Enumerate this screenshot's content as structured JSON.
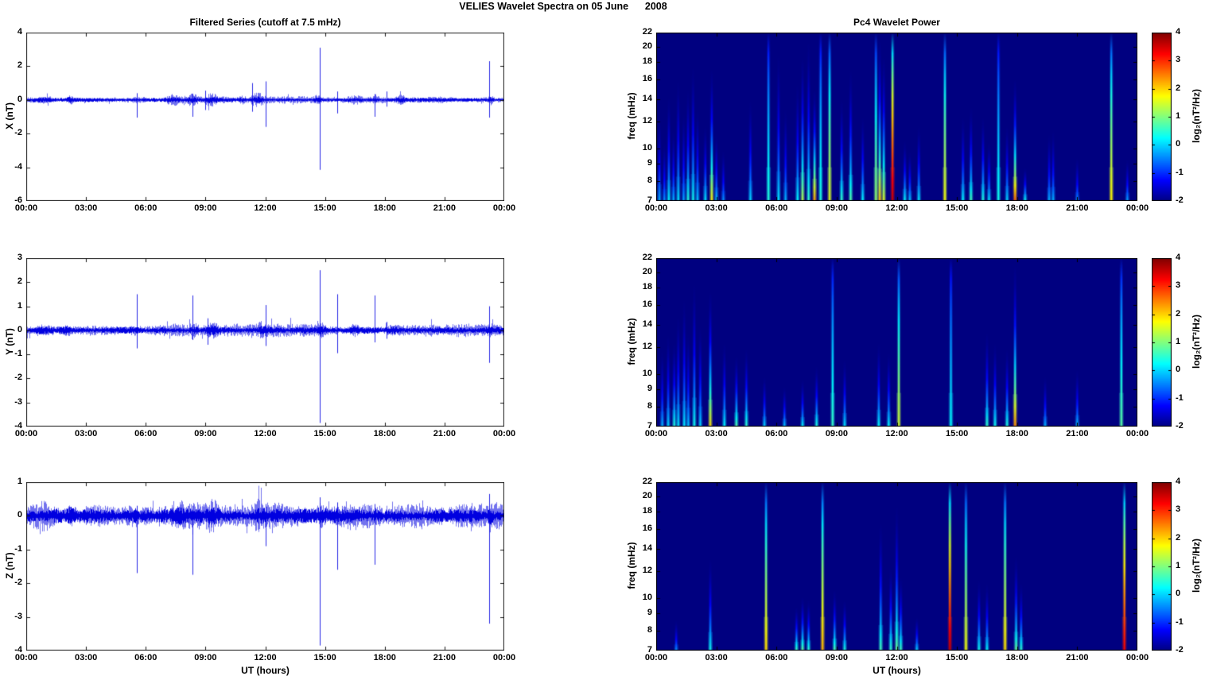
{
  "figure_title": "VELIES Wavelet Spectra on 05 June      2008",
  "ut_label": "UT (hours)",
  "time_ticks": [
    "00:00",
    "03:00",
    "06:00",
    "09:00",
    "12:00",
    "15:00",
    "18:00",
    "21:00",
    "00:00"
  ],
  "colors": {
    "series_line": "#0000e0",
    "axis": "#1a1a1a",
    "spectro_background": "#000080",
    "page_background": "#ffffff"
  },
  "colorbar": {
    "label": "log₂(nT²/Hz)",
    "ticks": [
      "4",
      "3",
      "2",
      "1",
      "0",
      "-1",
      "-2"
    ],
    "range": [
      -2,
      4
    ]
  },
  "chart_data": [
    {
      "type": "line",
      "title": "Filtered Series (cutoff at 7.5 mHz)",
      "ylabel": "X (nT)",
      "xlabel": "",
      "ylim": [
        -6,
        4
      ],
      "yticks": [
        "4",
        "2",
        "0",
        "-2",
        "-4",
        "-6"
      ],
      "xlim_hours": [
        0,
        24
      ],
      "noise_amp": 0.12,
      "bursts": [
        [
          0.9,
          1.6,
          0.06
        ],
        [
          2.2,
          0.5,
          0.1
        ],
        [
          7.4,
          1.2,
          0.1
        ],
        [
          8.3,
          0.8,
          0.12
        ],
        [
          9.3,
          1.0,
          0.14
        ],
        [
          10.8,
          0.6,
          0.08
        ],
        [
          11.6,
          0.9,
          0.16
        ],
        [
          14.6,
          0.6,
          0.1
        ],
        [
          16.4,
          1.4,
          0.07
        ],
        [
          17.5,
          0.5,
          0.08
        ],
        [
          18.8,
          0.7,
          0.09
        ],
        [
          23.3,
          0.5,
          0.12
        ]
      ],
      "spikes": [
        [
          5.55,
          0.4,
          -1.05
        ],
        [
          8.35,
          0.35,
          -1.0
        ],
        [
          9.0,
          0.55,
          -0.6
        ],
        [
          11.35,
          1.0,
          -0.7
        ],
        [
          12.0,
          1.1,
          -1.6
        ],
        [
          14.75,
          3.1,
          -4.15
        ],
        [
          15.6,
          0.5,
          -0.8
        ],
        [
          17.5,
          0.35,
          -1.0
        ],
        [
          18.1,
          0.5,
          -0.4
        ],
        [
          23.25,
          2.3,
          -1.05
        ]
      ]
    },
    {
      "type": "line",
      "title": "",
      "ylabel": "Y (nT)",
      "xlabel": "",
      "ylim": [
        -4,
        3
      ],
      "yticks": [
        "3",
        "2",
        "1",
        "0",
        "-1",
        "-2",
        "-3",
        "-4"
      ],
      "xlim_hours": [
        0,
        24
      ],
      "noise_amp": 0.14,
      "bursts": [
        [
          0.9,
          1.6,
          0.05
        ],
        [
          2.1,
          0.6,
          0.08
        ],
        [
          5.5,
          0.4,
          0.06
        ],
        [
          8.4,
          0.8,
          0.08
        ],
        [
          9.3,
          0.8,
          0.08
        ],
        [
          11.8,
          0.9,
          0.08
        ],
        [
          14.8,
          0.5,
          0.06
        ],
        [
          16.5,
          1.0,
          0.06
        ],
        [
          18.3,
          0.8,
          0.06
        ],
        [
          23.3,
          0.4,
          0.08
        ]
      ],
      "spikes": [
        [
          5.55,
          1.5,
          -0.75
        ],
        [
          8.35,
          1.45,
          -0.4
        ],
        [
          9.1,
          0.5,
          -0.6
        ],
        [
          12.0,
          1.05,
          -0.65
        ],
        [
          14.75,
          2.5,
          -3.85
        ],
        [
          15.6,
          1.5,
          -0.95
        ],
        [
          17.5,
          1.45,
          -0.5
        ],
        [
          18.1,
          0.35,
          -0.35
        ],
        [
          23.25,
          1.0,
          -1.35
        ]
      ]
    },
    {
      "type": "line",
      "title": "",
      "ylabel": "Z (nT)",
      "xlabel": "UT (hours)",
      "ylim": [
        -4,
        1
      ],
      "yticks": [
        "1",
        "0",
        "-1",
        "-2",
        "-3",
        "-4"
      ],
      "xlim_hours": [
        0,
        24
      ],
      "noise_amp": 0.2,
      "bursts": [
        [
          0.9,
          1.4,
          0.05
        ],
        [
          2.2,
          0.6,
          0.06
        ],
        [
          5.5,
          0.4,
          0.06
        ],
        [
          7.6,
          1.4,
          0.08
        ],
        [
          9.3,
          1.0,
          0.08
        ],
        [
          11.7,
          0.9,
          0.1
        ],
        [
          14.7,
          0.5,
          0.06
        ],
        [
          16.3,
          1.2,
          0.06
        ],
        [
          18.6,
          0.8,
          0.06
        ],
        [
          23.3,
          0.4,
          0.1
        ]
      ],
      "spikes": [
        [
          5.55,
          0.3,
          -1.7
        ],
        [
          8.35,
          0.3,
          -1.75
        ],
        [
          12.0,
          0.35,
          -0.9
        ],
        [
          14.75,
          0.55,
          -3.85
        ],
        [
          15.6,
          0.4,
          -1.6
        ],
        [
          17.5,
          0.35,
          -1.45
        ],
        [
          23.25,
          0.65,
          -3.2
        ]
      ]
    },
    {
      "type": "heatmap",
      "title": "Pc4 Wavelet Power",
      "ylabel": "freq (mHz)",
      "xlabel": "",
      "ylim_mhz": [
        7,
        22
      ],
      "yscale": "log",
      "yticks": [
        "22",
        "20",
        "18",
        "16",
        "14",
        "12",
        "10",
        "9",
        "8",
        "7"
      ],
      "xlim_hours": [
        0,
        24
      ],
      "clim": [
        -2,
        4
      ],
      "streaks": [
        [
          0.16,
          0.5,
          0.5
        ],
        [
          0.41,
          0.35,
          0.3
        ],
        [
          0.63,
          0.62,
          0.9
        ],
        [
          0.86,
          0.42,
          0.5
        ],
        [
          1.1,
          0.72,
          0.8
        ],
        [
          1.37,
          0.52,
          0.4
        ],
        [
          1.59,
          0.66,
          1.1
        ],
        [
          1.84,
          0.8,
          1.0
        ],
        [
          2.06,
          0.55,
          0.6
        ],
        [
          2.45,
          0.45,
          0.8
        ],
        [
          2.77,
          0.78,
          2.3
        ],
        [
          3.0,
          0.4,
          0.6
        ],
        [
          3.35,
          0.3,
          0.3
        ],
        [
          4.7,
          0.6,
          0.7
        ],
        [
          5.6,
          1.0,
          1.1
        ],
        [
          6.1,
          0.88,
          0.8
        ],
        [
          6.45,
          0.55,
          0.5
        ],
        [
          7.05,
          0.7,
          0.9
        ],
        [
          7.3,
          0.85,
          1.9
        ],
        [
          7.6,
          0.95,
          1.2
        ],
        [
          7.9,
          0.66,
          2.7
        ],
        [
          8.2,
          1.0,
          1.1
        ],
        [
          8.65,
          1.0,
          2.1
        ],
        [
          9.25,
          0.6,
          1.2
        ],
        [
          9.7,
          0.78,
          1.4
        ],
        [
          10.3,
          0.5,
          0.9
        ],
        [
          10.96,
          1.0,
          1.7
        ],
        [
          11.15,
          0.96,
          2.5
        ],
        [
          11.35,
          0.86,
          2.1
        ],
        [
          11.79,
          1.0,
          3.7
        ],
        [
          12.4,
          0.36,
          0.9
        ],
        [
          12.65,
          0.3,
          0.6
        ],
        [
          13.1,
          0.45,
          0.8
        ],
        [
          14.4,
          1.0,
          2.2
        ],
        [
          15.3,
          0.5,
          0.9
        ],
        [
          15.7,
          0.56,
          1.3
        ],
        [
          16.3,
          0.5,
          1.1
        ],
        [
          16.6,
          0.35,
          0.8
        ],
        [
          17.07,
          1.0,
          1.0
        ],
        [
          17.5,
          0.45,
          0.7
        ],
        [
          17.9,
          0.72,
          3.0
        ],
        [
          18.4,
          0.2,
          1.0
        ],
        [
          19.6,
          0.4,
          0.5
        ],
        [
          19.8,
          0.42,
          0.5
        ],
        [
          21.0,
          0.26,
          0.3
        ],
        [
          22.7,
          1.0,
          2.3
        ],
        [
          23.5,
          0.25,
          0.4
        ]
      ]
    },
    {
      "type": "heatmap",
      "title": "",
      "ylabel": "freq (mHz)",
      "xlabel": "",
      "ylim_mhz": [
        7,
        22
      ],
      "yscale": "log",
      "yticks": [
        "22",
        "20",
        "18",
        "16",
        "14",
        "12",
        "10",
        "9",
        "8",
        "7"
      ],
      "xlim_hours": [
        0,
        24
      ],
      "clim": [
        -2,
        4
      ],
      "streaks": [
        [
          0.3,
          0.45,
          0.5
        ],
        [
          0.6,
          0.55,
          0.7
        ],
        [
          0.9,
          0.5,
          1.1
        ],
        [
          1.1,
          0.66,
          0.8
        ],
        [
          1.4,
          0.76,
          0.8
        ],
        [
          1.6,
          0.56,
          0.6
        ],
        [
          1.9,
          0.86,
          1.0
        ],
        [
          2.2,
          0.6,
          0.7
        ],
        [
          2.7,
          0.8,
          2.4
        ],
        [
          3.4,
          0.5,
          0.9
        ],
        [
          4.0,
          0.42,
          1.4
        ],
        [
          4.5,
          0.46,
          1.2
        ],
        [
          5.4,
          0.3,
          0.7
        ],
        [
          6.4,
          0.24,
          0.6
        ],
        [
          7.3,
          0.28,
          0.9
        ],
        [
          8.0,
          0.36,
          1.1
        ],
        [
          8.8,
          1.0,
          1.2
        ],
        [
          9.4,
          0.4,
          0.8
        ],
        [
          11.1,
          0.5,
          0.9
        ],
        [
          11.6,
          0.44,
          0.9
        ],
        [
          12.1,
          1.0,
          2.0
        ],
        [
          14.7,
          1.0,
          0.9
        ],
        [
          16.5,
          0.56,
          1.2
        ],
        [
          16.9,
          0.5,
          1.0
        ],
        [
          17.5,
          0.46,
          1.1
        ],
        [
          17.9,
          0.96,
          2.8
        ],
        [
          19.4,
          0.3,
          0.5
        ],
        [
          21.0,
          0.34,
          0.6
        ],
        [
          23.2,
          1.0,
          1.4
        ]
      ]
    },
    {
      "type": "heatmap",
      "title": "",
      "ylabel": "freq (mHz)",
      "xlabel": "UT (hours)",
      "ylim_mhz": [
        7,
        22
      ],
      "yscale": "log",
      "yticks": [
        "22",
        "20",
        "18",
        "16",
        "14",
        "12",
        "10",
        "9",
        "8",
        "7"
      ],
      "xlim_hours": [
        0,
        24
      ],
      "clim": [
        -2,
        4
      ],
      "streaks": [
        [
          1.0,
          0.18,
          0.3
        ],
        [
          2.7,
          0.55,
          1.0
        ],
        [
          5.48,
          1.0,
          2.4
        ],
        [
          7.0,
          0.26,
          1.3
        ],
        [
          7.3,
          0.32,
          1.5
        ],
        [
          7.6,
          0.3,
          1.2
        ],
        [
          8.3,
          1.0,
          2.6
        ],
        [
          8.9,
          0.36,
          1.4
        ],
        [
          9.4,
          0.3,
          1.1
        ],
        [
          11.2,
          0.76,
          1.3
        ],
        [
          11.7,
          0.5,
          1.2
        ],
        [
          12.0,
          0.86,
          1.5
        ],
        [
          12.2,
          0.44,
          1.3
        ],
        [
          13.0,
          0.2,
          0.7
        ],
        [
          14.65,
          1.0,
          3.7
        ],
        [
          15.45,
          1.0,
          2.2
        ],
        [
          16.1,
          0.42,
          1.0
        ],
        [
          16.5,
          0.4,
          0.9
        ],
        [
          17.4,
          1.0,
          2.4
        ],
        [
          17.95,
          0.56,
          1.5
        ],
        [
          18.2,
          0.4,
          1.2
        ],
        [
          23.35,
          1.0,
          3.5
        ]
      ]
    }
  ]
}
